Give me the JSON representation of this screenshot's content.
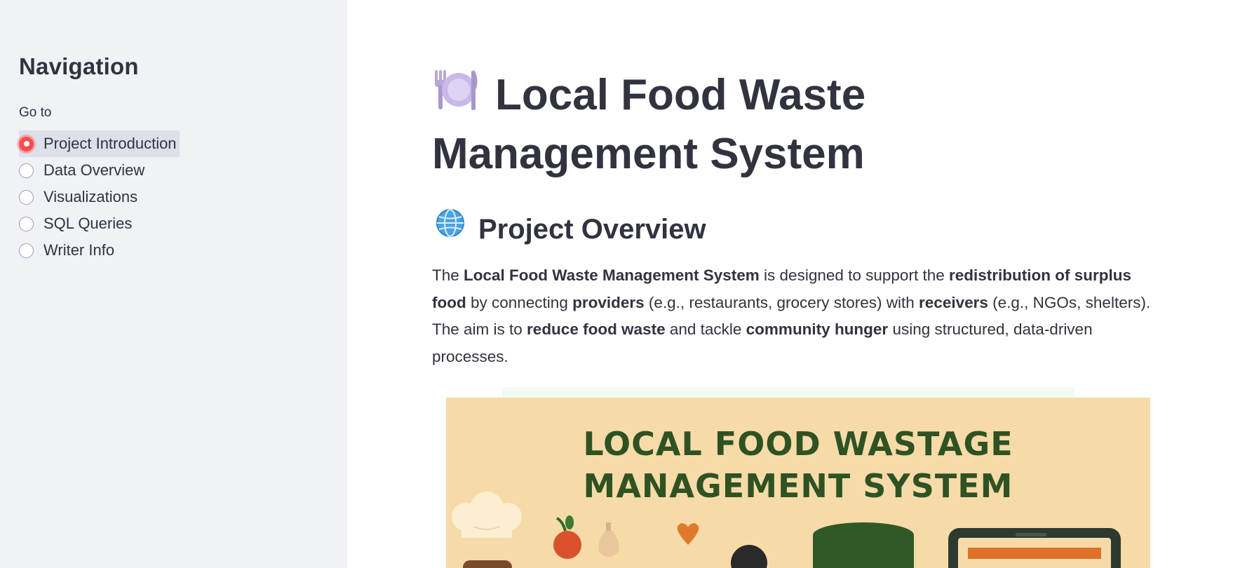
{
  "sidebar": {
    "title": "Navigation",
    "goto_label": "Go to",
    "options": [
      {
        "label": "Project Introduction",
        "selected": true
      },
      {
        "label": "Data Overview",
        "selected": false
      },
      {
        "label": "Visualizations",
        "selected": false
      },
      {
        "label": "SQL Queries",
        "selected": false
      },
      {
        "label": "Writer Info",
        "selected": false
      }
    ]
  },
  "main": {
    "title": "Local Food Waste Management System",
    "title_icon": "plate-with-cutlery-icon",
    "overview_heading": "Project Overview",
    "overview_icon": "globe-icon",
    "paragraph": {
      "p1": "The ",
      "b1": "Local Food Waste Management System",
      "p2": " is designed to support the ",
      "b2": "redistribution of surplus food",
      "p3": " by connecting ",
      "b3": "providers",
      "p4": " (e.g., restaurants, grocery stores) with ",
      "b4": "receivers",
      "p5": " (e.g., NGOs, shelters).",
      "p6": "The aim is to ",
      "b5": "reduce food waste",
      "p7": " and tackle ",
      "b6": "community hunger",
      "p8": " using structured, data-driven processes."
    },
    "banner": {
      "line1": "LOCAL FOOD WASTAGE",
      "line2": "MANAGEMENT SYSTEM"
    }
  },
  "colors": {
    "sidebar_bg": "#f0f2f6",
    "accent": "#ff4b4b",
    "text": "#31333f",
    "banner_bg": "#f6dba8",
    "banner_text": "#2f5223"
  }
}
